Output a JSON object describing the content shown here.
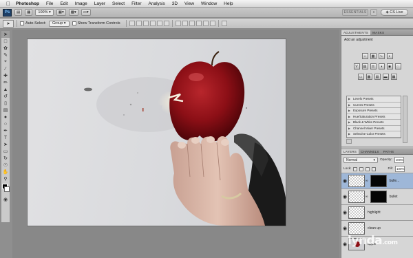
{
  "menubar": {
    "items": [
      "Photoshop",
      "File",
      "Edit",
      "Image",
      "Layer",
      "Select",
      "Filter",
      "Analysis",
      "3D",
      "View",
      "Window",
      "Help"
    ]
  },
  "appbar": {
    "logo": "Ps",
    "zoom": "100%",
    "essentials": "ESSENTIALS",
    "double_arrow": "»",
    "cs_live": "CS Live"
  },
  "options": {
    "auto_select_label": "Auto-Select:",
    "auto_select_value": "Group",
    "show_transform_label": "Show Transform Controls"
  },
  "adjustments": {
    "tab_active": "ADJUSTMENTS",
    "tab_other": "MASKS",
    "title": "Add an adjustment",
    "presets": [
      "Levels Presets",
      "Curves Presets",
      "Exposure Presets",
      "Hue/Saturation Presets",
      "Black & White Presets",
      "Channel Mixer Presets",
      "Selective Color Presets"
    ]
  },
  "layers_panel": {
    "tabs": [
      "LAYERS",
      "CHANNELS",
      "PATHS"
    ],
    "blend_mode": "Normal",
    "opacity_label": "Opacity:",
    "opacity_value": "100%",
    "lock_label": "Lock:",
    "fill_label": "Fill:",
    "fill_value": "100%",
    "layers": [
      {
        "name": "bulle..."
      },
      {
        "name": "bullet"
      },
      {
        "name": "highlight"
      },
      {
        "name": "clean up"
      },
      {
        "name": "apple"
      }
    ]
  },
  "watermark": {
    "text": "lynda",
    "suffix": ".com"
  },
  "colors": {
    "accent_active_layer": "#9eb7d8",
    "apple_red": "#8c0f16"
  }
}
